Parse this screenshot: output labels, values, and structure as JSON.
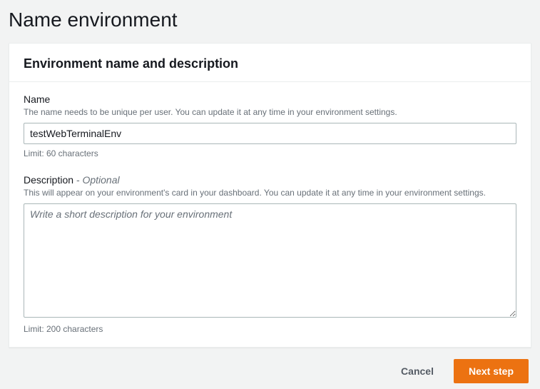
{
  "page": {
    "title": "Name environment"
  },
  "panel": {
    "heading": "Environment name and description"
  },
  "fields": {
    "name": {
      "label": "Name",
      "help": "The name needs to be unique per user. You can update it at any time in your environment settings.",
      "value": "testWebTerminalEnv",
      "constraint": "Limit: 60 characters"
    },
    "description": {
      "label": "Description",
      "optional_tag": "- Optional",
      "help": "This will appear on your environment's card in your dashboard. You can update it at any time in your environment settings.",
      "value": "",
      "placeholder": "Write a short description for your environment",
      "constraint": "Limit: 200 characters"
    }
  },
  "footer": {
    "cancel": "Cancel",
    "next": "Next step"
  }
}
